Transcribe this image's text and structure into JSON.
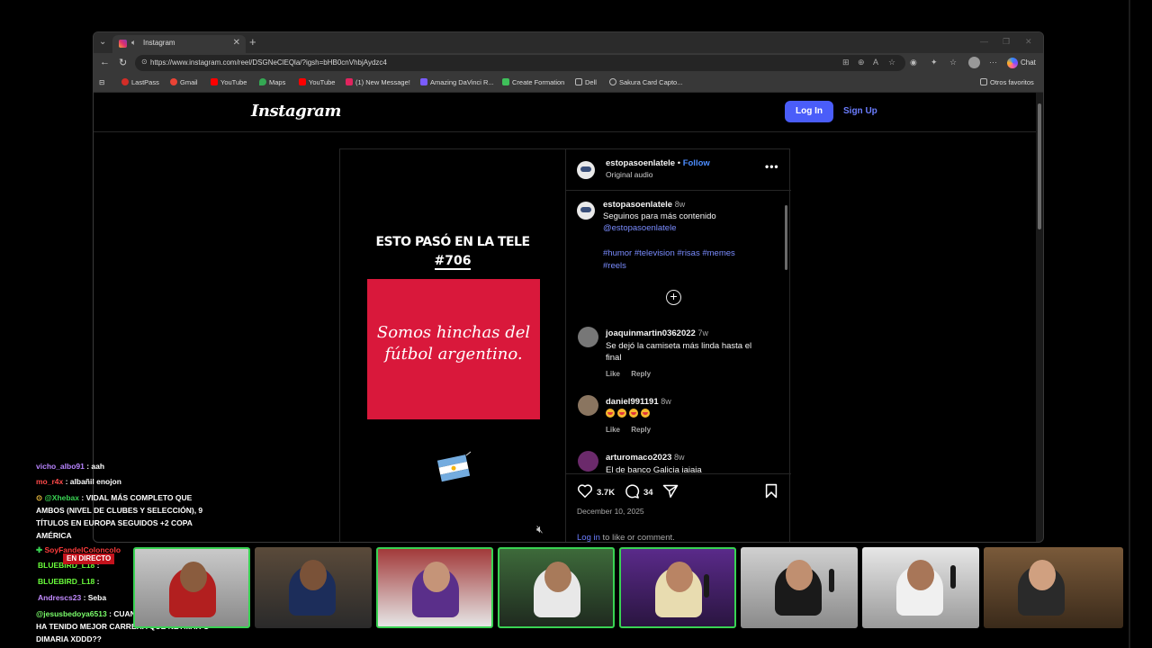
{
  "browser": {
    "tab_title": "Instagram",
    "url": "https://www.instagram.com/reel/DSGNeClEQla/?igsh=bHB0cnVhbjAydzc4",
    "copilot_label": "Chat",
    "bookmarks": [
      "LastPass",
      "Gmail",
      "YouTube",
      "Maps",
      "YouTube",
      "(1) New Message!",
      "Amazing DaVinci R...",
      "Create Formation",
      "Dell",
      "Sakura Card Capto..."
    ],
    "other_favorites": "Otros favoritos",
    "colors": {
      "chrome": "#383838",
      "page": "#000000",
      "accent": "#4a5df9"
    }
  },
  "instagram": {
    "logo": "Instagram",
    "login_label": "Log In",
    "signup_label": "Sign Up",
    "video": {
      "title_line": "ESTO PASÓ EN LA TELE",
      "episode": "#706",
      "card_text_1": "Somos hinchas del",
      "card_text_2": "fútbol argentino."
    },
    "post_header": {
      "username": "estopasoenlatele",
      "dot": "•",
      "follow": "Follow",
      "audio": "Original audio"
    },
    "caption": {
      "username": "estopasoenlatele",
      "time": "8w",
      "text": "Seguinos para más contenido",
      "mention": "@estopasoenlatele",
      "tags_1": "#humor #television #risas #memes",
      "tags_2": "#reels"
    },
    "comments": [
      {
        "username": "joaquinmartin0362022",
        "time": "7w",
        "text": "Se dejó la camiseta más linda hasta el final",
        "like": "Like",
        "reply": "Reply"
      },
      {
        "username": "daniel991191",
        "time": "8w",
        "text": "",
        "like": "Like",
        "reply": "Reply"
      },
      {
        "username": "arturomaco2023",
        "time": "8w",
        "text": "El de banco Galicia jajaja"
      }
    ],
    "likes": "3.7K",
    "comment_count": "34",
    "date": "December 10, 2025",
    "login_link": "Log in",
    "login_rest": " to like or comment."
  },
  "stream_chat": [
    {
      "name": "vicho_albo91",
      "text": " : aah",
      "color": "#b884ff"
    },
    {
      "name": "mo_r4x",
      "text": " : albañil enojon",
      "color": "#ff4a4a"
    },
    {
      "name": "@Xhebax",
      "text": " : VIDAL MÁS COMPLETO QUE AMBOS (NIVEL DE CLUBES Y SELECCIÓN), 9 TÍTULOS EN EUROPA SEGUIDOS +2 COPA AMÉRICA",
      "color": "#39d353"
    },
    {
      "name": "SoyFandelColoncolo",
      "text": "",
      "color": "#ff3b3b"
    },
    {
      "name": "BLUEBIRD_L18",
      "text": " :",
      "color": "#6bff3c"
    },
    {
      "name": "BLUEBIRD_L18",
      "text": " :",
      "color": "#6bff3c"
    },
    {
      "name": "Andrescs23",
      "text": " : Seba",
      "color": "#c38bff"
    },
    {
      "name": "@jesusbedoya6513",
      "text": " : CUANDO ALEXIS SANCHEZ HA TENIDO MEJOR CARRERA QUE NEYMAR O DIMARIA XDDD??",
      "color": "#7bff6b"
    }
  ],
  "live_badge": "EN DIRECTO"
}
